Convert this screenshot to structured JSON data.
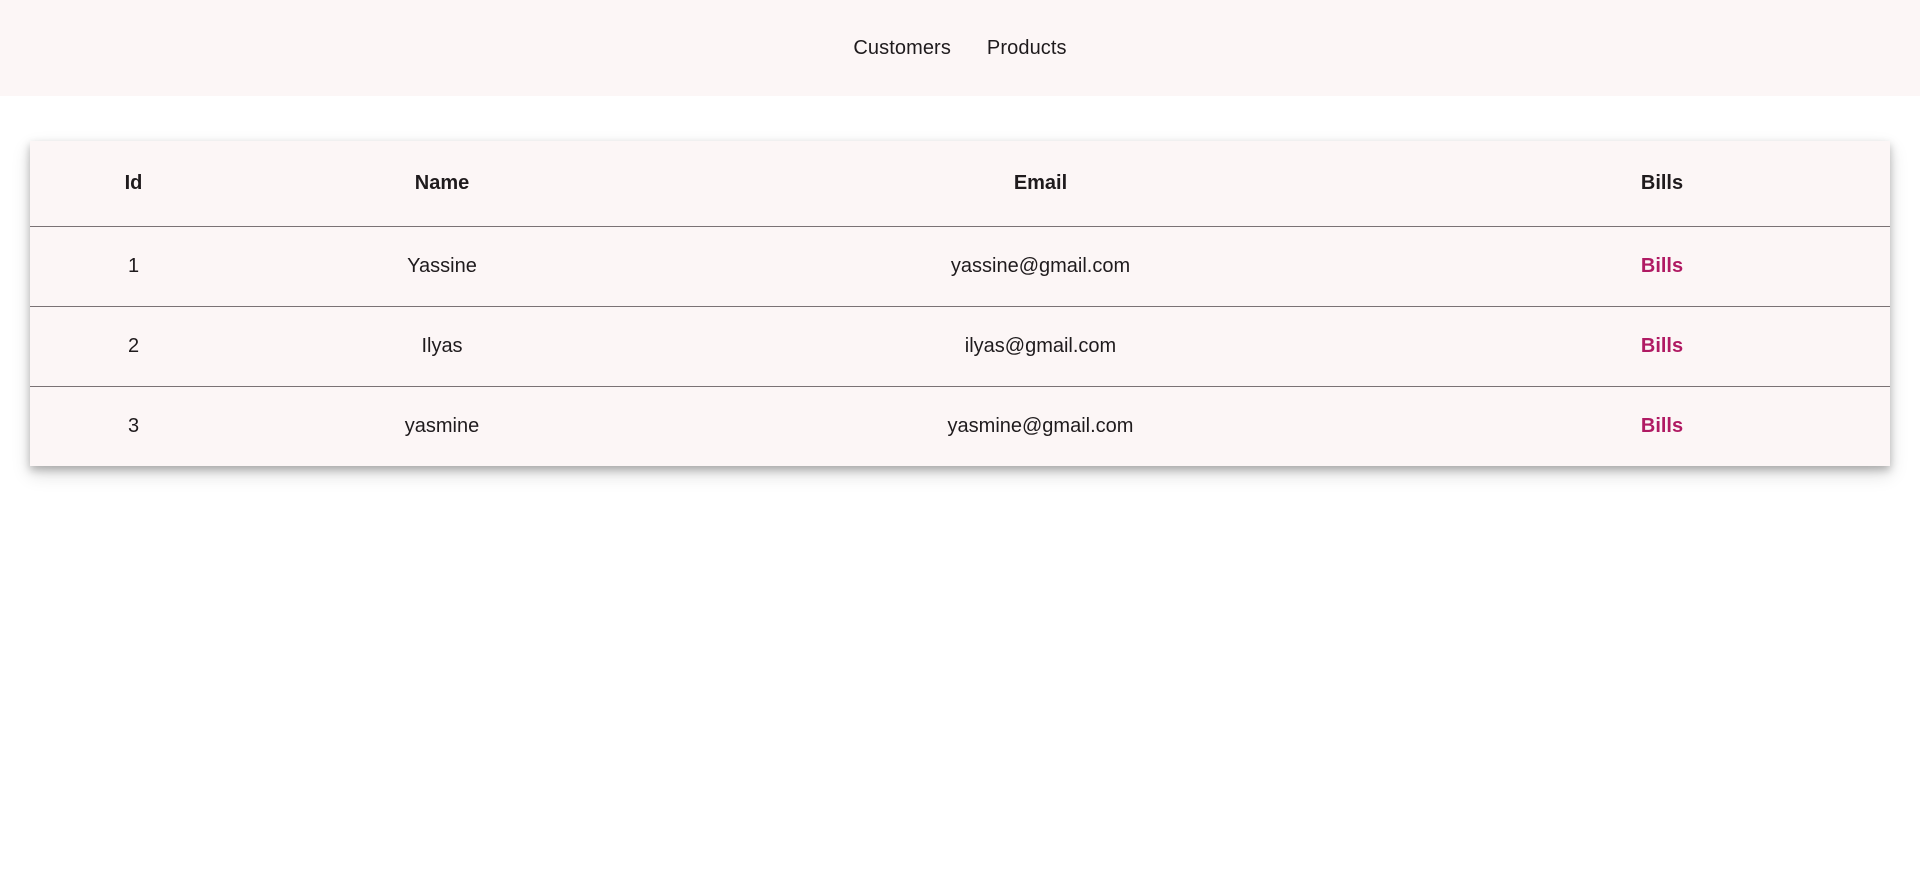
{
  "nav": {
    "items": [
      {
        "label": "Customers"
      },
      {
        "label": "Products"
      }
    ]
  },
  "table": {
    "headers": {
      "id": "Id",
      "name": "Name",
      "email": "Email",
      "bills": "Bills"
    },
    "rows": [
      {
        "id": "1",
        "name": "Yassine",
        "email": "yassine@gmail.com",
        "bills": "Bills"
      },
      {
        "id": "2",
        "name": "Ilyas",
        "email": "ilyas@gmail.com",
        "bills": "Bills"
      },
      {
        "id": "3",
        "name": "yasmine",
        "email": "yasmine@gmail.com",
        "bills": "Bills"
      }
    ]
  },
  "colors": {
    "header_bg": "#fcf6f6",
    "accent": "#b01a63",
    "text": "#1f1b1d"
  }
}
